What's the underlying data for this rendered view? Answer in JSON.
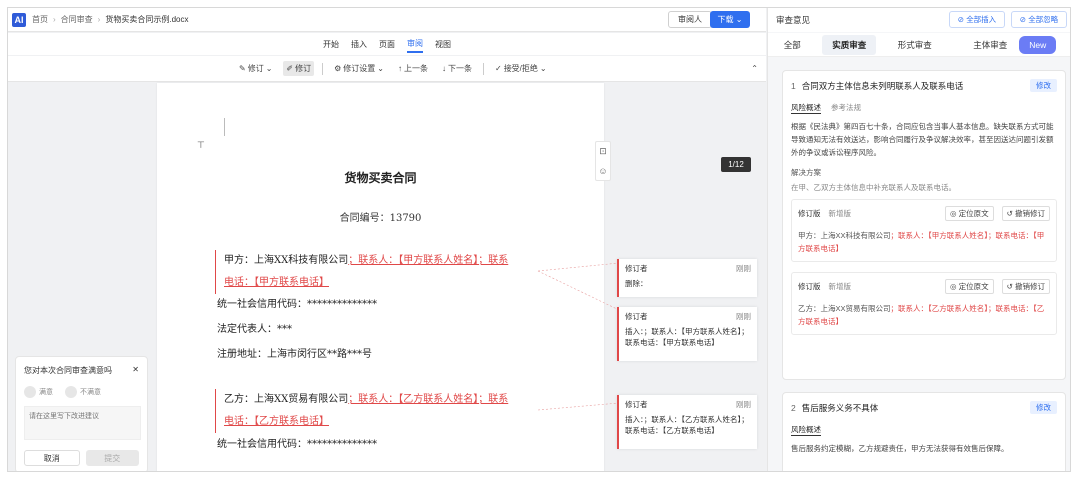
{
  "app": {
    "logo": "AI"
  },
  "breadcrumb": [
    "首页",
    "合同审查",
    "货物买卖合同示例.docx"
  ],
  "header": {
    "reviewer_btn": "审阅人",
    "download_btn": "下载 ⌄"
  },
  "menu": [
    "开始",
    "插入",
    "页面",
    "审阅",
    "视图"
  ],
  "menu_active": "审阅",
  "toolbar": {
    "items": [
      "修订",
      "修订",
      "修订设置",
      "上一条",
      "下一条",
      "接受/拒绝"
    ],
    "page_indicator": "1/12"
  },
  "doc": {
    "title": "货物买卖合同",
    "contract_no": "合同编号：13790",
    "party_a": {
      "line1_plain": "甲方：上海XX科技有限公司",
      "line1_red": "；联系人：【甲方联系人姓名】；联系",
      "line2_red": "电话：【甲方联系电话】",
      "credit": "统一社会信用代码：**************",
      "legal": "法定代表人：***",
      "address": "注册地址：上海市闵行区**路***号"
    },
    "party_b": {
      "line1_plain": "乙方：上海XX贸易有限公司",
      "line1_red": "；联系人：【乙方联系人姓名】；联系",
      "line2_red": "电话：【乙方联系电话】",
      "credit": "统一社会信用代码：**************"
    }
  },
  "revisions": [
    {
      "author": "修订者",
      "time": "刚刚",
      "body": "删除："
    },
    {
      "author": "修订者",
      "time": "刚刚",
      "body": "插入：；联系人：【甲方联系人姓名】；联系电话：【甲方联系电话】"
    },
    {
      "author": "修订者",
      "time": "刚刚",
      "body": "插入：；联系人：【乙方联系人姓名】；联系电话：【乙方联系电话】"
    }
  ],
  "feedback": {
    "question": "您对本次合同审查满意吗",
    "satisfied": "满意",
    "unsatisfied": "不满意",
    "placeholder": "请在这里写下改进建议",
    "cancel": "取消",
    "submit": "提交"
  },
  "panel": {
    "title": "审查意见",
    "insert_all": "全部插入",
    "ignore_all": "全部忽略",
    "tabs": [
      "全部",
      "实质审查",
      "形式审查",
      "主体审查"
    ],
    "active_tab": "实质审查",
    "new_badge": "New",
    "issues": [
      {
        "num": "1",
        "title": "合同双方主体信息未列明联系人及联系电话",
        "edit": "修改",
        "subtabs": [
          "风险概述",
          "参考法规"
        ],
        "desc": "根据《民法典》第四百七十条，合同应包含当事人基本信息。缺失联系方式可能导致通知无法有效送达，影响合同履行及争议解决效率，甚至因送达问题引发额外的争议或诉讼程序风险。",
        "solution_title": "解决方案",
        "solution": "在甲、乙双方主体信息中补充联系人及联系电话。",
        "suggestions": [
          {
            "tab_a": "修订版",
            "tab_b": "新增版",
            "locate": "定位原文",
            "undo": "撤销修订",
            "text_plain": "甲方：上海XX科技有限公司",
            "text_red": "；联系人：【甲方联系人姓名】；联系电话：【甲方联系电话】"
          },
          {
            "tab_a": "修订版",
            "tab_b": "新增版",
            "locate": "定位原文",
            "undo": "撤销修订",
            "text_plain": "乙方：上海XX贸易有限公司",
            "text_red": "；联系人：【乙方联系人姓名】；联系电话：【乙方联系电话】"
          }
        ]
      },
      {
        "num": "2",
        "title": "售后服务义务不具体",
        "edit": "修改",
        "subtabs": [
          "风险概述"
        ],
        "desc": "售后服务约定模糊，乙方规避责任，甲方无法获得有效售后保障。"
      }
    ]
  }
}
